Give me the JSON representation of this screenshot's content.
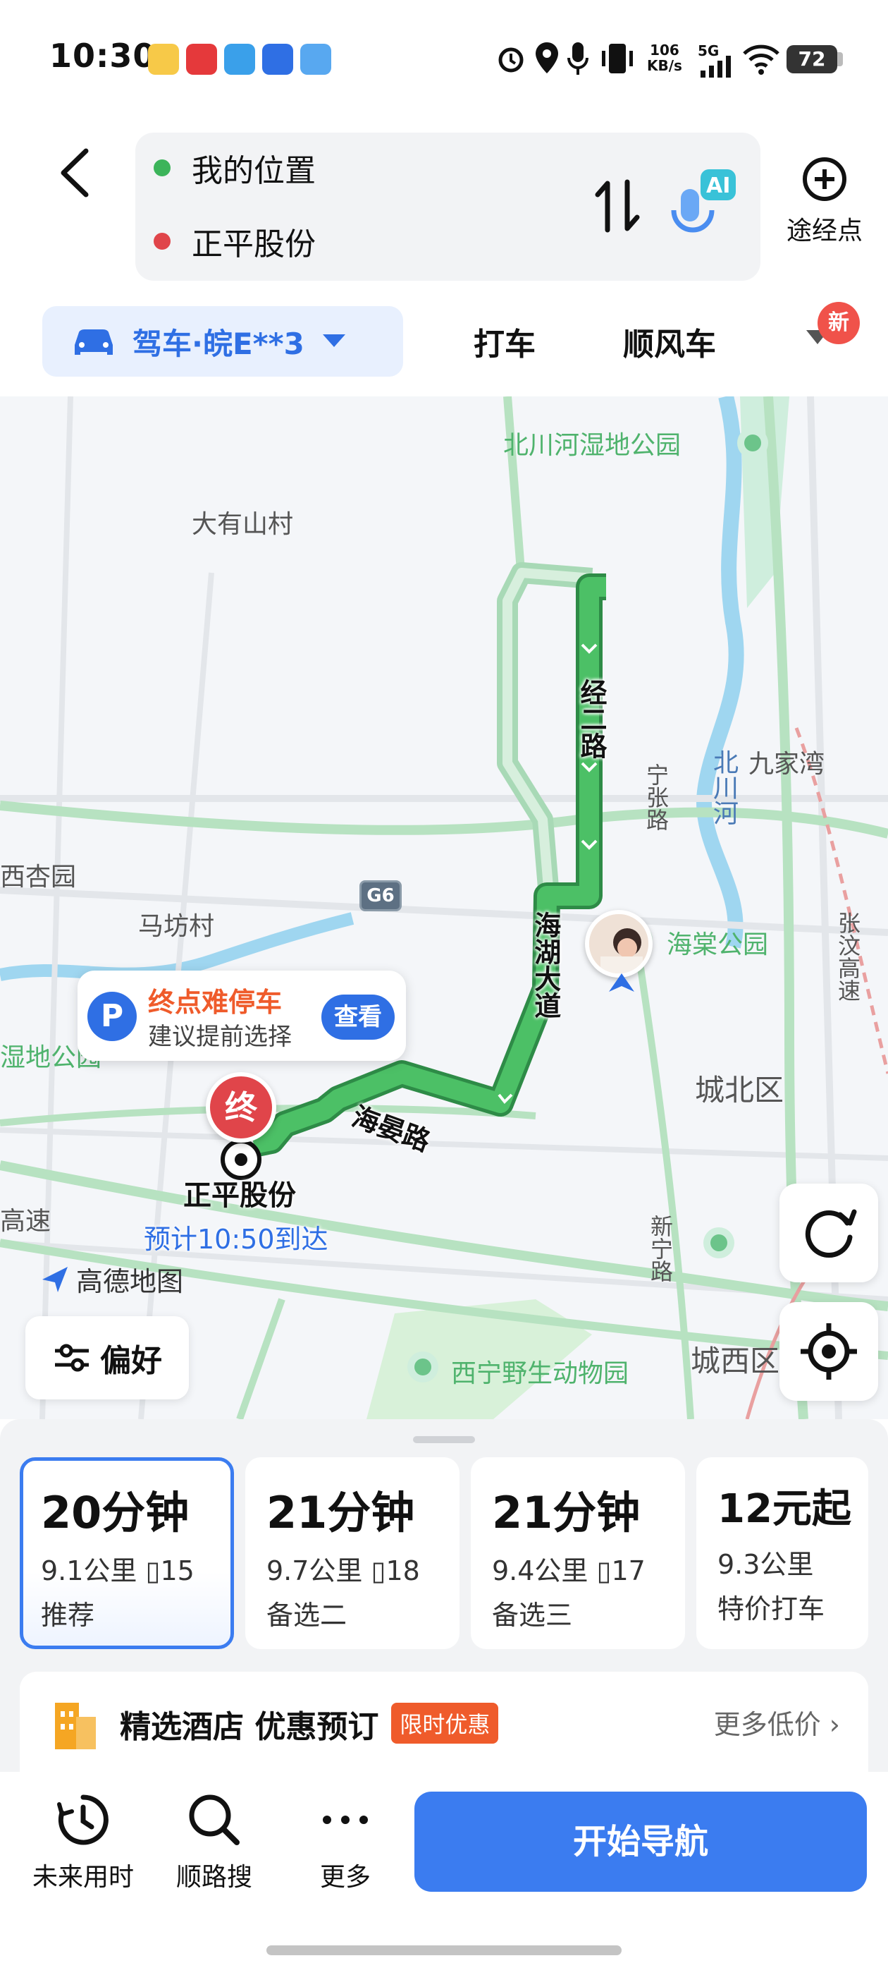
{
  "status_bar": {
    "time": "10:30",
    "net_speed_value": "106",
    "net_speed_unit": "KB/s",
    "signal": "5G",
    "battery": "72"
  },
  "route": {
    "origin": "我的位置",
    "destination": "正平股份",
    "origin_dot_color": "#3cb45a",
    "destination_dot_color": "#e0454a",
    "ai_label": "AI",
    "waypoint_label": "途经点"
  },
  "modes": {
    "drive": "驾车·皖E**3",
    "taxi": "打车",
    "carpool": "顺风车",
    "new_badge": "新"
  },
  "map": {
    "labels": {
      "wetland_park": "北川河湿地公园",
      "dayoushan": "大有山村",
      "jiujiawan": "九家湾",
      "xixingyuan": "西杏园",
      "mafang": "马坊村",
      "haitang_park": "海棠公园",
      "chengbei": "城北区",
      "wetland_left": "湿地公园",
      "highway_left": "高速",
      "zhangwen": "张汶高速",
      "ningzhang": "宁张路",
      "beichuan_river": "北川河",
      "xinning": "新宁路",
      "zoo": "西宁野生动物园",
      "chengxi": "城西区",
      "g6": "G6",
      "ren": "人"
    },
    "roads": {
      "jinger": "经二路",
      "haihu": "海湖大道",
      "haiyan": "海晏路"
    },
    "parking": {
      "icon": "P",
      "title": "终点难停车",
      "subtitle": "建议提前选择",
      "action": "查看"
    },
    "end_pin": "终",
    "destination_name": "正平股份",
    "eta": "预计10:50到达",
    "logo": "高德地图",
    "preference": "偏好"
  },
  "routes": [
    {
      "duration": "20分钟",
      "distance": "9.1公里",
      "lights": "15",
      "tag": "推荐",
      "selected": true
    },
    {
      "duration": "21分钟",
      "distance": "9.7公里",
      "lights": "18",
      "tag": "备选二",
      "selected": false
    },
    {
      "duration": "21分钟",
      "distance": "9.4公里",
      "lights": "17",
      "tag": "备选三",
      "selected": false
    },
    {
      "duration": "12元起",
      "distance": "9.3公里",
      "lights": "",
      "tag": "特价打车",
      "selected": false
    }
  ],
  "hotel": {
    "title": "精选酒店 优惠预订",
    "badge": "限时优惠",
    "more": "更多低价"
  },
  "footer": {
    "future": "未来用时",
    "along_search": "顺路搜",
    "more": "更多",
    "start": "开始导航"
  },
  "colors": {
    "accent": "#3b7cf0",
    "route_green": "#43b05c",
    "alt_route": "#a8d9b6",
    "warning": "#ef5b2b"
  }
}
